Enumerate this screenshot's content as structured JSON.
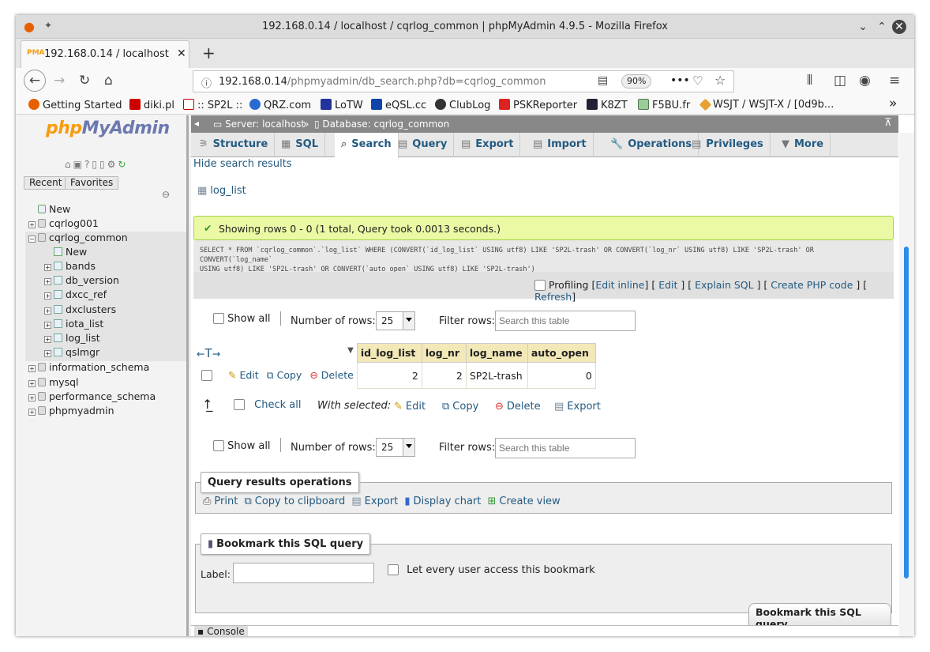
{
  "window": {
    "title": "192.168.0.14 / localhost / cqrlog_common | phpMyAdmin 4.9.5 - Mozilla Firefox"
  },
  "tab": {
    "label": "192.168.0.14 / localhost / c",
    "favicon": "pma-icon"
  },
  "url": {
    "host": "192.168.0.14",
    "path": "/phpmyadmin/db_search.php?db=cqrlog_common",
    "zoom": "90%"
  },
  "bookmarks": [
    "Getting Started",
    "diki.pl",
    ":: SP2L ::",
    "QRZ.com",
    "LoTW",
    "eQSL.cc",
    "ClubLog",
    "PSKReporter",
    "K8ZT",
    "F5BU.fr",
    "WSJT / WSJT-X / [0d9b..."
  ],
  "nav": {
    "logo_a": "php",
    "logo_b": "MyAdmin",
    "recent": "Recent",
    "favorites": "Favorites",
    "tree": [
      {
        "label": "New",
        "level": 0
      },
      {
        "label": "cqrlog001",
        "level": 0
      },
      {
        "label": "cqrlog_common",
        "level": 0
      },
      {
        "label": "New",
        "level": 1
      },
      {
        "label": "bands",
        "level": 1
      },
      {
        "label": "db_version",
        "level": 1
      },
      {
        "label": "dxcc_ref",
        "level": 1
      },
      {
        "label": "dxclusters",
        "level": 1
      },
      {
        "label": "iota_list",
        "level": 1
      },
      {
        "label": "log_list",
        "level": 1
      },
      {
        "label": "qslmgr",
        "level": 1
      },
      {
        "label": "information_schema",
        "level": 0
      },
      {
        "label": "mysql",
        "level": 0
      },
      {
        "label": "performance_schema",
        "level": 0
      },
      {
        "label": "phpmyadmin",
        "level": 0
      }
    ]
  },
  "breadcrumb": {
    "server": "Server: localhost",
    "sep": "»",
    "database": "Database: cqrlog_common"
  },
  "menu": [
    "Structure",
    "SQL",
    "Search",
    "Query",
    "Export",
    "Import",
    "Operations",
    "Privileges",
    "More"
  ],
  "hide_results": "Hide search results",
  "table_link": "log_list",
  "success": "Showing rows 0 - 0 (1 total, Query took 0.0013 seconds.)",
  "sql": {
    "l1a": "SELECT * FROM `cqrlog_common`.`log_list` WHERE (CONVERT(`id_log_list` USING utf8) LIKE 'SP2L-trash' OR CONVERT(`log_nr` USING utf8) LIKE 'SP2L-trash' OR CONVERT(`log_name`",
    "l2a": "USING utf8) LIKE 'SP2L-trash' OR CONVERT(`auto_open` USING utf8) LIKE 'SP2L-trash')"
  },
  "profiling": {
    "label": "Profiling",
    "links": [
      "Edit inline",
      "Edit",
      "Explain SQL",
      "Create PHP code",
      "Refresh"
    ]
  },
  "controls": {
    "show_all": "Show all",
    "num_rows_label": "Number of rows:",
    "num_rows": "25",
    "filter_label": "Filter rows:",
    "filter_placeholder": "Search this table"
  },
  "table": {
    "columns": [
      "id_log_list",
      "log_nr",
      "log_name",
      "auto_open"
    ],
    "rows": [
      [
        "2",
        "2",
        "SP2L-trash",
        "0"
      ]
    ],
    "actions": [
      "Edit",
      "Copy",
      "Delete"
    ]
  },
  "bulk": {
    "check_all": "Check all",
    "with_selected": "With selected:",
    "actions": [
      "Edit",
      "Copy",
      "Delete",
      "Export"
    ]
  },
  "ops": {
    "legend": "Query results operations",
    "items": [
      "Print",
      "Copy to clipboard",
      "Export",
      "Display chart",
      "Create view"
    ]
  },
  "bookmark": {
    "legend": "Bookmark this SQL query",
    "label": "Label:",
    "share": "Let every user access this bookmark",
    "button": "Bookmark this SQL query"
  },
  "console": "Console"
}
